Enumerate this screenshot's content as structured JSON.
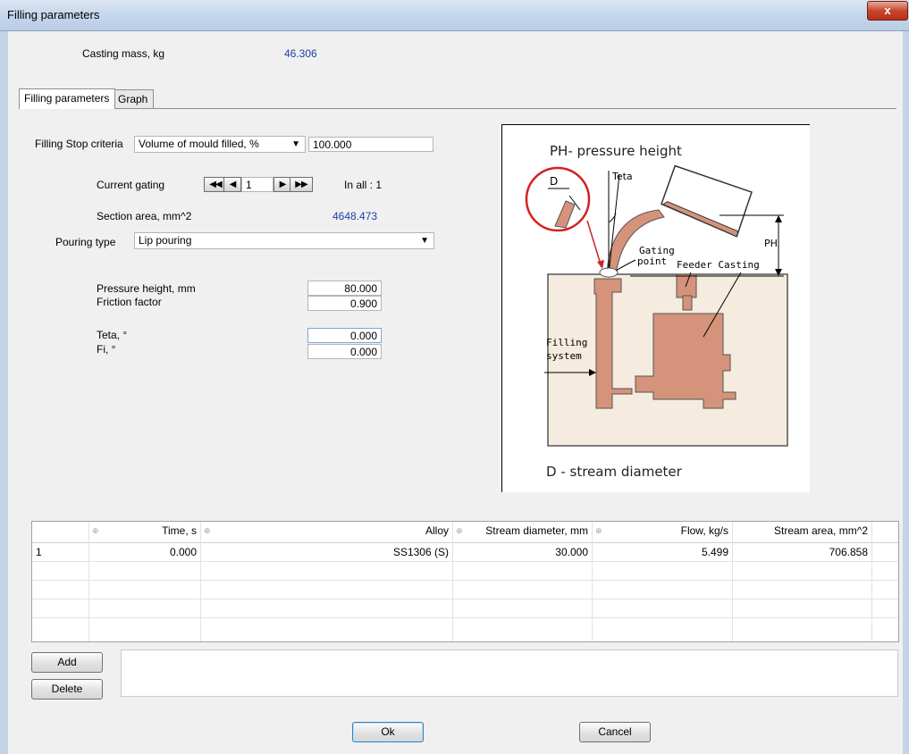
{
  "window": {
    "title": "Filling parameters",
    "close_glyph": "x"
  },
  "header": {
    "casting_mass_label": "Casting mass, kg",
    "casting_mass_value": "46.306"
  },
  "tabs": [
    {
      "label": "Filling parameters",
      "active": true
    },
    {
      "label": "Graph",
      "active": false
    }
  ],
  "filling": {
    "stop_criteria_label": "Filling Stop criteria",
    "stop_criteria_selected": "Volume of mould filled, %",
    "stop_criteria_value": "100.000",
    "current_gating_label": "Current gating",
    "current_gating_value": "1",
    "in_all_label": "In all : 1",
    "section_area_label": "Section area, mm^2",
    "section_area_value": "4648.473",
    "pouring_type_label": "Pouring type",
    "pouring_type_selected": "Lip pouring",
    "pressure_height_label": "Pressure height, mm",
    "pressure_height_value": "80.000",
    "friction_factor_label": "Friction factor",
    "friction_factor_value": "0.900",
    "teta_label": "Teta, °",
    "teta_value": "0.000",
    "fi_label": "Fi, °",
    "fi_value": "0.000"
  },
  "diagram": {
    "title": "PH- pressure height",
    "footer": "D - stream diameter",
    "label_d": "D",
    "label_teta": "Teta",
    "label_ph": "PH",
    "label_gating_1": "Gating",
    "label_gating_2": "point",
    "label_feeder_casting": "Feeder Casting",
    "label_filling_1": "Filling",
    "label_filling_2": "system",
    "colors": {
      "metal": "#d4937a",
      "mould": "#f5ebdf",
      "callout": "#d42020"
    }
  },
  "table": {
    "columns": [
      "Time, s",
      "Alloy",
      "Stream diameter, mm",
      "Flow, kg/s",
      "Stream area, mm^2"
    ],
    "rows": [
      {
        "index": "1",
        "time": "0.000",
        "alloy": "SS1306 (S)",
        "stream_diameter": "30.000",
        "flow": "5.499",
        "stream_area": "706.858"
      }
    ]
  },
  "buttons": {
    "add": "Add",
    "delete": "Delete",
    "ok": "Ok",
    "cancel": "Cancel"
  }
}
